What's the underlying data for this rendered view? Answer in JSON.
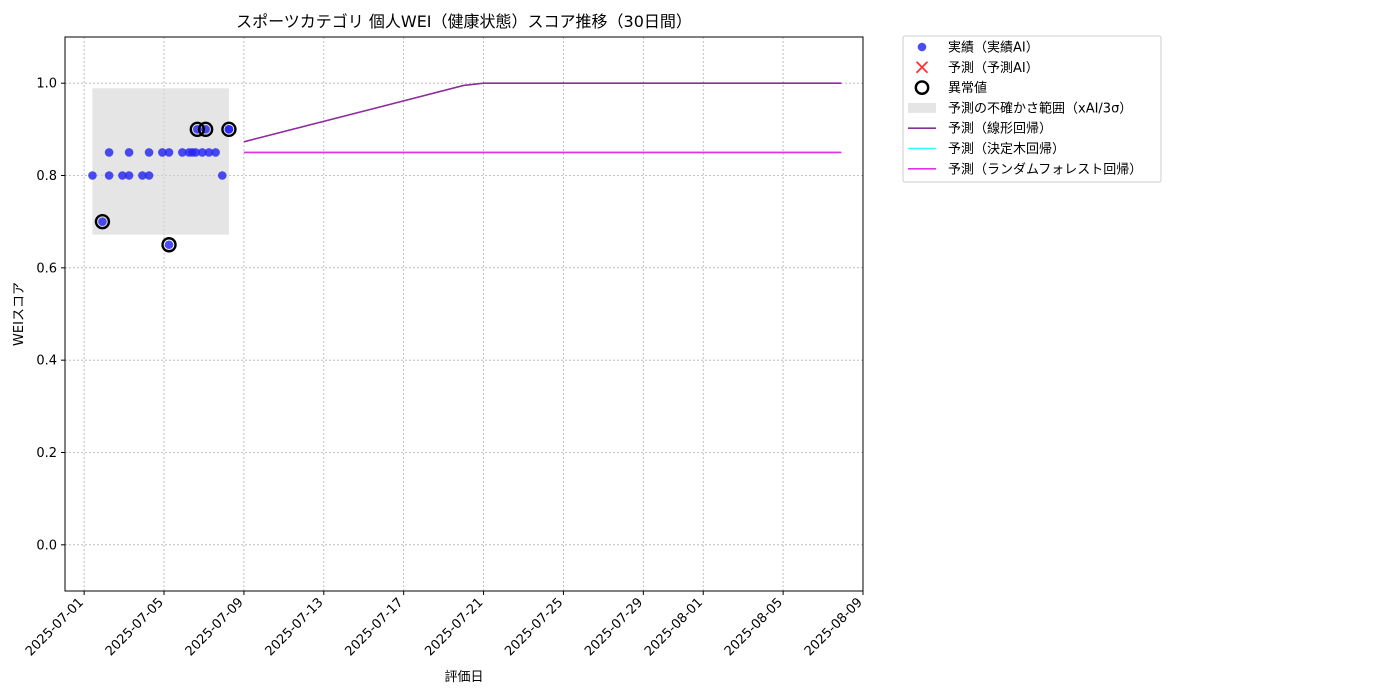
{
  "chart_data": {
    "type": "scatter",
    "title": "スポーツカテゴリ 個人WEI（健康状態）スコア推移（30日間）",
    "xlabel": "評価日",
    "ylabel": "WEIスコア",
    "xlim": [
      "2025-06-30T01:00",
      "2025-08-09T00:00"
    ],
    "ylim": [
      -0.1,
      1.1
    ],
    "yticks": [
      0.0,
      0.2,
      0.4,
      0.6,
      0.8,
      1.0
    ],
    "xticks": [
      "2025-07-01",
      "2025-07-05",
      "2025-07-09",
      "2025-07-13",
      "2025-07-17",
      "2025-07-21",
      "2025-07-25",
      "2025-07-29",
      "2025-08-01",
      "2025-08-05",
      "2025-08-09"
    ],
    "grid": true,
    "legend_position": "outside-right-top",
    "colors": {
      "actual": "#2424f0",
      "predicted_ai": "#ff3333",
      "anomaly_edge": "#000000",
      "uncertainty": "#d3d3d3",
      "linear": "#8b2f9b",
      "decision_tree": "#33ffff",
      "random_forest": "#e233e2"
    },
    "uncertainty_band": {
      "name": "予測の不確かさ範囲（xAI/3σ）",
      "x_start": "2025-07-01T10:00",
      "x_end": "2025-07-08T06:00",
      "y_low": 0.672,
      "y_high": 0.989
    },
    "series": [
      {
        "name": "実績（実績AI）",
        "kind": "scatter",
        "points": [
          {
            "x": "2025-07-01T10:00",
            "y": 0.8
          },
          {
            "x": "2025-07-01T22:00",
            "y": 0.7
          },
          {
            "x": "2025-07-02T06:00",
            "y": 0.85
          },
          {
            "x": "2025-07-02T06:00",
            "y": 0.8
          },
          {
            "x": "2025-07-02T22:00",
            "y": 0.8
          },
          {
            "x": "2025-07-03T06:00",
            "y": 0.85
          },
          {
            "x": "2025-07-03T06:00",
            "y": 0.8
          },
          {
            "x": "2025-07-03T22:00",
            "y": 0.8
          },
          {
            "x": "2025-07-04T06:00",
            "y": 0.85
          },
          {
            "x": "2025-07-04T06:00",
            "y": 0.8
          },
          {
            "x": "2025-07-04T22:00",
            "y": 0.85
          },
          {
            "x": "2025-07-05T06:00",
            "y": 0.85
          },
          {
            "x": "2025-07-05T06:00",
            "y": 0.65
          },
          {
            "x": "2025-07-05T22:00",
            "y": 0.85
          },
          {
            "x": "2025-07-06T06:00",
            "y": 0.85
          },
          {
            "x": "2025-07-06T10:00",
            "y": 0.85
          },
          {
            "x": "2025-07-06T14:00",
            "y": 0.85
          },
          {
            "x": "2025-07-06T16:00",
            "y": 0.9
          },
          {
            "x": "2025-07-06T22:00",
            "y": 0.85
          },
          {
            "x": "2025-07-07T02:00",
            "y": 0.9
          },
          {
            "x": "2025-07-07T06:00",
            "y": 0.85
          },
          {
            "x": "2025-07-07T14:00",
            "y": 0.85
          },
          {
            "x": "2025-07-07T22:00",
            "y": 0.8
          },
          {
            "x": "2025-07-08T06:00",
            "y": 0.9
          },
          {
            "x": "2025-07-08T06:00",
            "y": 0.9
          }
        ]
      },
      {
        "name": "予測（予測AI）",
        "kind": "marker-x",
        "points": []
      },
      {
        "name": "異常値",
        "kind": "ring",
        "points": [
          {
            "x": "2025-07-01T22:00",
            "y": 0.7
          },
          {
            "x": "2025-07-05T06:00",
            "y": 0.65
          },
          {
            "x": "2025-07-06T16:00",
            "y": 0.9
          },
          {
            "x": "2025-07-07T02:00",
            "y": 0.9
          },
          {
            "x": "2025-07-08T06:00",
            "y": 0.9
          }
        ]
      },
      {
        "name": "予測（線形回帰）",
        "kind": "line",
        "points": [
          {
            "x": "2025-07-09T00:00",
            "y": 0.873
          },
          {
            "x": "2025-07-20T00:00",
            "y": 0.995
          },
          {
            "x": "2025-07-21T00:00",
            "y": 1.0
          },
          {
            "x": "2025-08-07T22:00",
            "y": 1.0
          }
        ]
      },
      {
        "name": "予測（決定木回帰）",
        "kind": "line",
        "points": [
          {
            "x": "2025-07-09T00:00",
            "y": 0.85
          },
          {
            "x": "2025-08-07T22:00",
            "y": 0.85
          }
        ]
      },
      {
        "name": "予測（ランダムフォレスト回帰）",
        "kind": "line",
        "points": [
          {
            "x": "2025-07-09T00:00",
            "y": 0.85
          },
          {
            "x": "2025-08-07T22:00",
            "y": 0.85
          }
        ]
      }
    ],
    "legend": [
      {
        "label": "実績（実績AI）",
        "symbol": "dot",
        "color_key": "actual"
      },
      {
        "label": "予測（予測AI）",
        "symbol": "x",
        "color_key": "predicted_ai"
      },
      {
        "label": "異常値",
        "symbol": "ring",
        "color_key": "anomaly_edge"
      },
      {
        "label": "予測の不確かさ範囲（xAI/3σ）",
        "symbol": "patch",
        "color_key": "uncertainty"
      },
      {
        "label": "予測（線形回帰）",
        "symbol": "line",
        "color_key": "linear"
      },
      {
        "label": "予測（決定木回帰）",
        "symbol": "line",
        "color_key": "decision_tree"
      },
      {
        "label": "予測（ランダムフォレスト回帰）",
        "symbol": "line",
        "color_key": "random_forest"
      }
    ]
  }
}
